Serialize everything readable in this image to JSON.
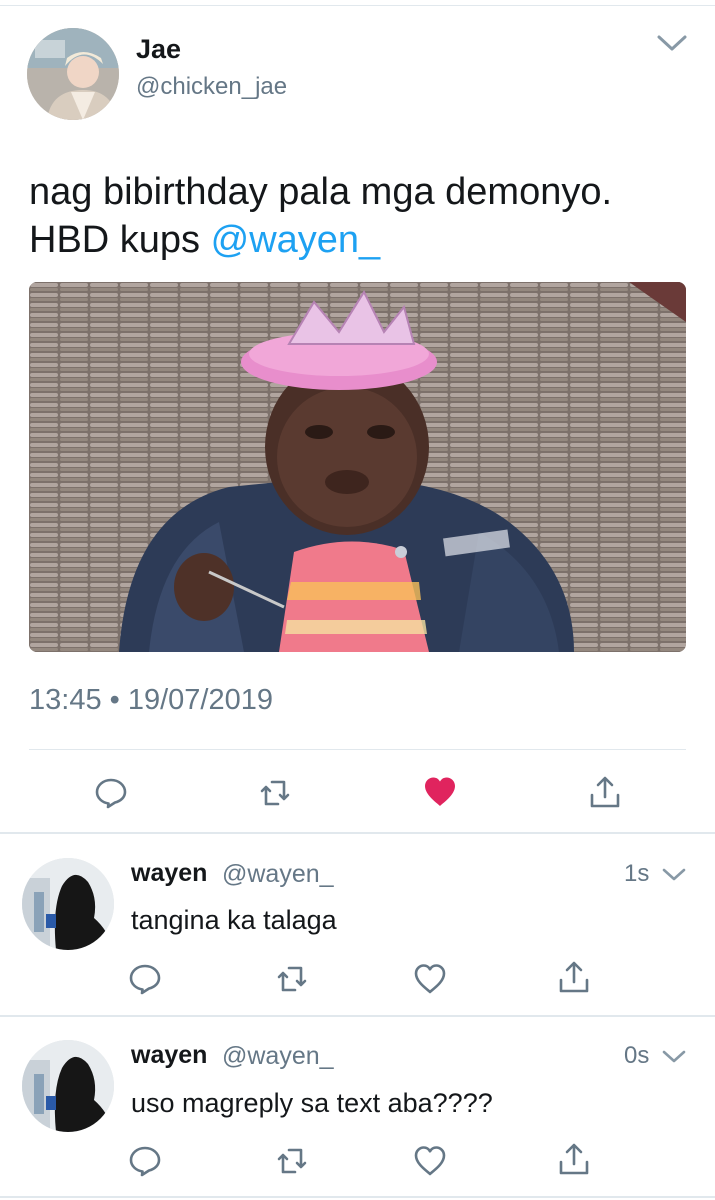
{
  "tweet": {
    "author_name": "Jae",
    "author_handle": "@chicken_jae",
    "text_line1": "nag bibirthday pala mga demonyo.",
    "text_line2_prefix": "HBD kups ",
    "mention": "@wayen_",
    "timestamp": "13:45 • 19/07/2019",
    "liked": true,
    "media_description_icon": "photo-of-child-with-pink-crown"
  },
  "replies": [
    {
      "name": "wayen",
      "handle": "@wayen_",
      "time": "1s",
      "text": "tangina ka talaga"
    },
    {
      "name": "wayen",
      "handle": "@wayen_",
      "time": "0s",
      "text": "uso magreply sa text aba????"
    }
  ],
  "colors": {
    "accent": "#1da1f2",
    "like": "#e0245e",
    "secondary_text": "#657786",
    "divider": "#e1e8ed",
    "icon": "#657786"
  },
  "icons": {
    "reply": "reply-icon",
    "retweet": "retweet-icon",
    "like": "heart-icon",
    "share": "share-icon",
    "more": "chevron-down-icon"
  }
}
